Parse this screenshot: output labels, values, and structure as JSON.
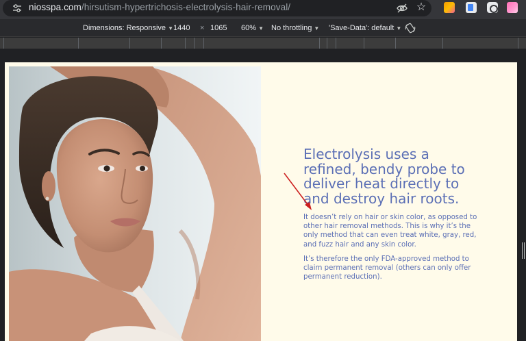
{
  "browser": {
    "url_host": "niosspa.com",
    "url_path": "/hirsutism-hypertrichosis-electrolysis-hair-removal/",
    "icons": [
      "tune-icon",
      "eye-off-icon",
      "star-icon",
      "extension-icons"
    ]
  },
  "devtools_toolbar": {
    "dimensions_label": "Dimensions: Responsive",
    "width_value": "1440",
    "times_sign": "×",
    "height_value": "1065",
    "zoom": "60%",
    "throttling": "No throttling",
    "save_data": "'Save-Data': default"
  },
  "page": {
    "headline": "Electrolysis uses a refined, bendy probe to deliver heat directly to and destroy hair roots.",
    "paragraph_1": "It doesn’t rely on hair or skin color, as opposed to other hair removal methods. This is why it’s the only method that can even treat white, gray, red, and fuzz hair and any skin color.",
    "paragraph_2": "It’s therefore the only FDA-approved method to claim permanent removal (others can only offer permanent reduction).",
    "text_color": "#5b6fb5",
    "background_color": "#fffbea",
    "annotation_arrow_color": "#cc1f1f"
  }
}
